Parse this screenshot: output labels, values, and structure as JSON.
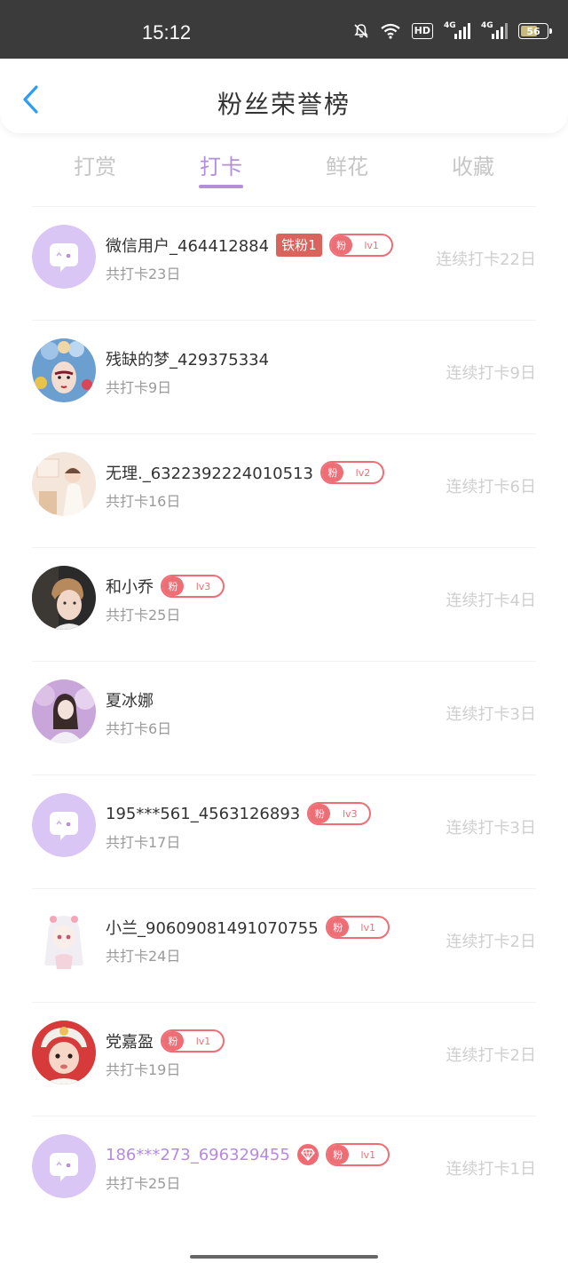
{
  "status_bar": {
    "time": "15:12",
    "hd_label": "HD",
    "sim1_label": "4G",
    "sim2_label": "4G",
    "battery_level": "56",
    "icons": [
      "bell-off-icon",
      "wifi-icon",
      "hd-icon",
      "signal-icon",
      "signal-icon",
      "battery-icon"
    ]
  },
  "header": {
    "title": "粉丝荣誉榜",
    "back_icon": "chevron-left-icon"
  },
  "tabs": [
    {
      "label": "打赏",
      "active": false
    },
    {
      "label": "打卡",
      "active": true
    },
    {
      "label": "鲜花",
      "active": false
    },
    {
      "label": "收藏",
      "active": false
    }
  ],
  "colors": {
    "accent": "#b48fd9",
    "badge_red": "#ee6e76",
    "iron_badge": "#d9645e",
    "muted": "#cfcfcf"
  },
  "fan_badge_key": "粉",
  "rows": [
    {
      "name": "微信用户_464412884",
      "iron_badge": "铁粉1",
      "level": "lv1",
      "total": "共打卡23日",
      "streak": "连续打卡22日",
      "avatar": "default"
    },
    {
      "name": "残缺的梦_429375334",
      "total": "共打卡9日",
      "streak": "连续打卡9日",
      "avatar": "opera"
    },
    {
      "name": "无理._6322392224010513",
      "level": "lv2",
      "total": "共打卡16日",
      "streak": "连续打卡6日",
      "avatar": "room"
    },
    {
      "name": "和小乔",
      "level": "lv3",
      "total": "共打卡25日",
      "streak": "连续打卡4日",
      "avatar": "boy"
    },
    {
      "name": "夏冰娜",
      "total": "共打卡6日",
      "streak": "连续打卡3日",
      "avatar": "girl"
    },
    {
      "name": "195***561_4563126893",
      "level": "lv3",
      "total": "共打卡17日",
      "streak": "连续打卡3日",
      "avatar": "default"
    },
    {
      "name": "小兰_90609081491070755",
      "level": "lv1",
      "total": "共打卡24日",
      "streak": "连续打卡2日",
      "avatar": "anime"
    },
    {
      "name": "党嘉盈",
      "level": "lv1",
      "total": "共打卡19日",
      "streak": "连续打卡2日",
      "avatar": "baby"
    },
    {
      "name": "186***273_696329455",
      "vip": true,
      "level": "lv1",
      "total": "共打卡25日",
      "streak": "连续打卡1日",
      "avatar": "default"
    }
  ]
}
